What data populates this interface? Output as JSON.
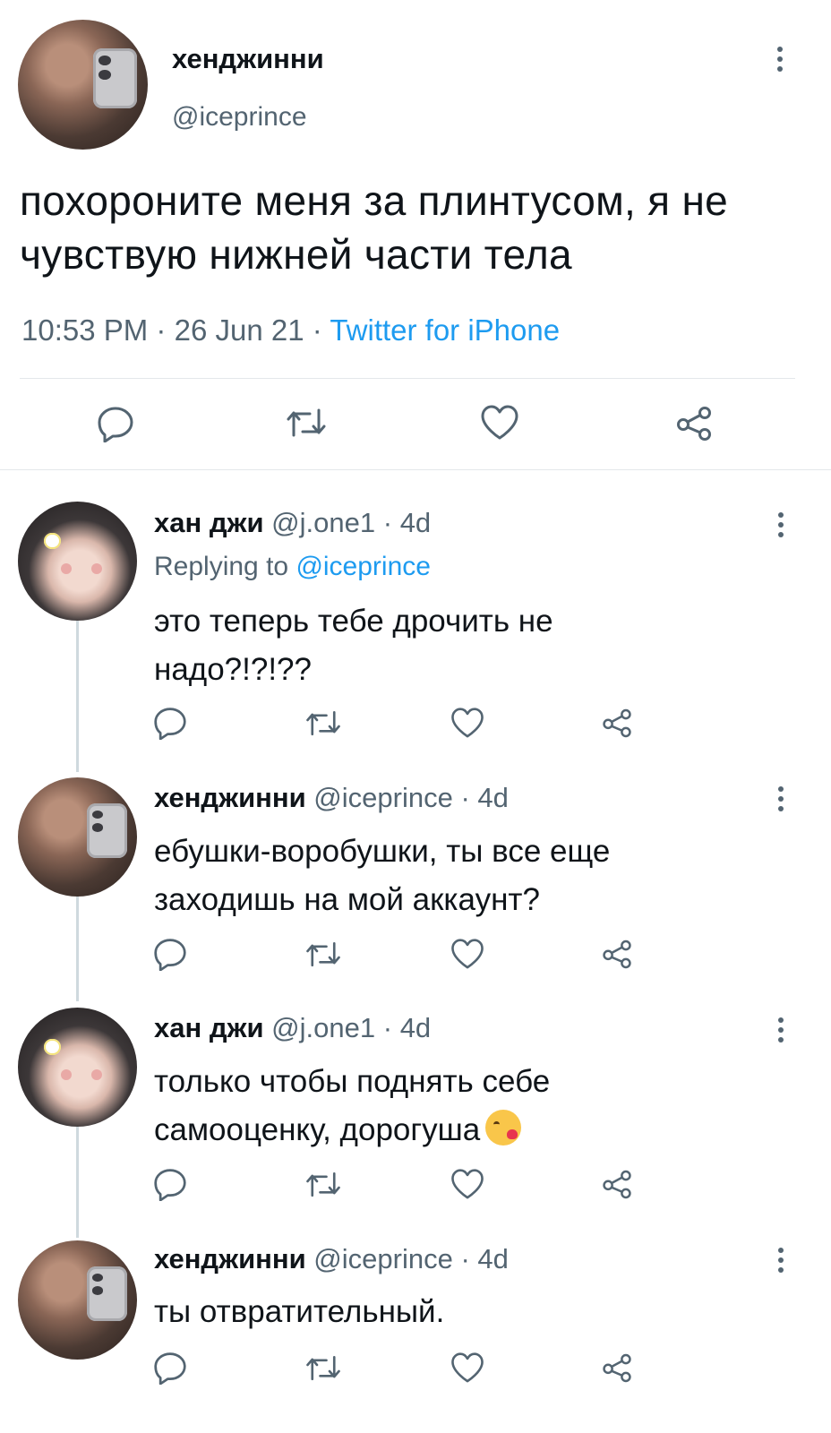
{
  "main_tweet": {
    "author_name": "хенджинни",
    "author_handle": "@iceprince",
    "text": "похороните меня за плинтусом, я не чувствую нижней части тела",
    "time": "10:53 PM",
    "date": "26 Jun 21",
    "source": "Twitter for iPhone",
    "separator": "·"
  },
  "icons": {
    "reply": "reply-bubble-icon",
    "retweet": "retweet-icon",
    "like": "heart-icon",
    "share": "share-icon",
    "more": "more-vertical-icon"
  },
  "replies": [
    {
      "author_name": "хан джи",
      "author_handle": "@j.one1",
      "age": "4d",
      "replying_prefix": "Replying to",
      "replying_handle": "@iceprince",
      "lines": [
        "это теперь тебе дрочить не",
        "надо?!?!??"
      ]
    },
    {
      "author_name": "хенджинни",
      "author_handle": "@iceprince",
      "age": "4d",
      "lines": [
        "ебушки-воробушки, ты все еще",
        "заходишь на мой аккаунт?"
      ]
    },
    {
      "author_name": "хан джи",
      "author_handle": "@j.one1",
      "age": "4d",
      "lines": [
        "только чтобы поднять себе",
        "самооценку, дорогуша"
      ],
      "emoji": "kissing-face-emoji"
    },
    {
      "author_name": "хенджинни",
      "author_handle": "@iceprince",
      "age": "4d",
      "lines": [
        "ты отвратительный."
      ]
    }
  ],
  "colors": {
    "link": "#1d9bf0",
    "secondary_text": "#536471",
    "primary_text": "#0f1419",
    "divider": "#e4e7ea"
  }
}
